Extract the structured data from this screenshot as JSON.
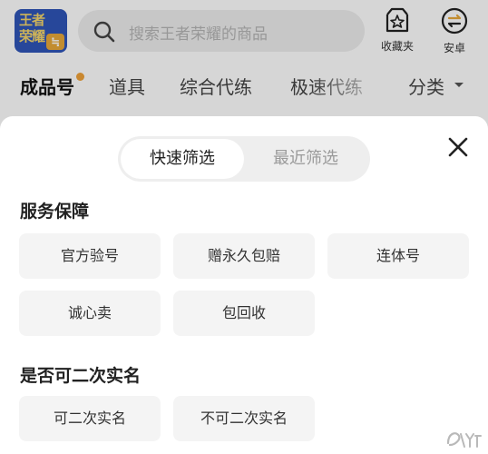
{
  "header": {
    "logo_text": "王者荣耀",
    "logo_badge": "≒",
    "search_placeholder": "搜索王者荣耀的商品",
    "favorites_label": "收藏夹",
    "platform_label": "安卓"
  },
  "categories": [
    {
      "label": "成品号",
      "active": true
    },
    {
      "label": "道具"
    },
    {
      "label": "综合代练"
    },
    {
      "label": "极速代练"
    },
    {
      "label": "分类"
    }
  ],
  "sheet": {
    "tabs": [
      "快速筛选",
      "最近筛选"
    ],
    "active_tab": "快速筛选",
    "sections": [
      {
        "title": "服务保障",
        "options": [
          "官方验号",
          "赠永久包赔",
          "连体号",
          "诚心卖",
          "包回收"
        ]
      },
      {
        "title": "是否可二次实名",
        "options": [
          "可二次实名",
          "不可二次实名"
        ]
      }
    ]
  },
  "colors": {
    "brand_blue": "#2f55b8",
    "logo_gold": "#f4d46a",
    "notice_dot": "#f0a23a",
    "chip_bg": "#f4f4f4"
  }
}
